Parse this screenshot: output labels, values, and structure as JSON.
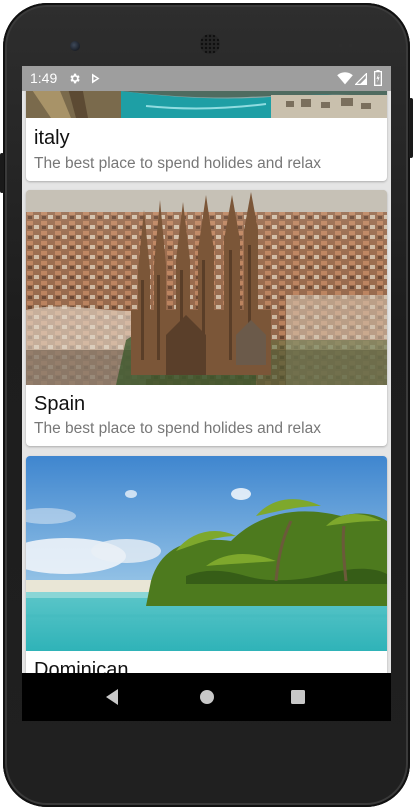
{
  "status_bar": {
    "time": "1:49",
    "background": "#9e9e9e",
    "icons": [
      "settings-icon",
      "play-store-icon",
      "wifi-icon",
      "cellular-signal-icon",
      "battery-icon"
    ]
  },
  "destinations": [
    {
      "title": "italy",
      "description": "The best place to spend holides and relax",
      "image": "italy-coastline-photo"
    },
    {
      "title": "Spain",
      "description": "The best place to spend holides and relax",
      "image": "spain-sagrada-familia-photo"
    },
    {
      "title": "Dominican",
      "description": "",
      "image": "dominican-palm-beach-photo"
    }
  ],
  "nav_bar": {
    "buttons": [
      "back-icon",
      "home-icon",
      "recents-icon"
    ]
  }
}
